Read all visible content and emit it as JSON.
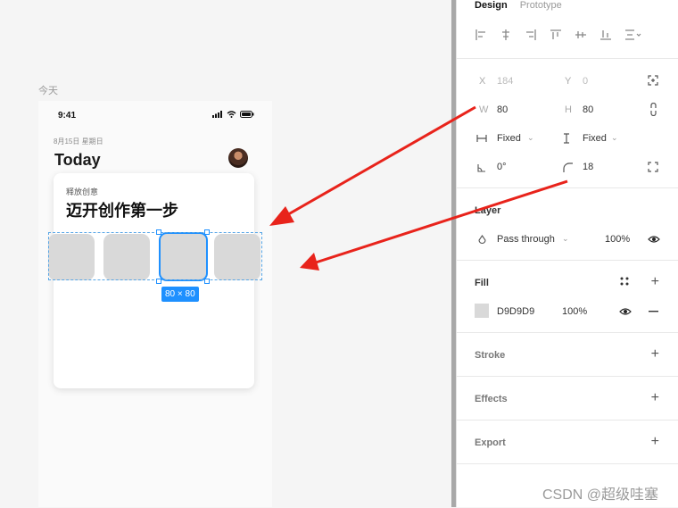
{
  "canvas": {
    "frame_label": "今天",
    "status_time": "9:41",
    "date_line": "8月15日 星期日",
    "heading": "Today",
    "card_subtitle": "释放创意",
    "card_title": "迈开创作第一步",
    "size_badge": "80 × 80"
  },
  "panel": {
    "tabs": [
      "Design",
      "Prototype"
    ],
    "geometry": {
      "x_label": "X",
      "x_value": "184",
      "y_label": "Y",
      "y_value": "0",
      "w_label": "W",
      "w_value": "80",
      "h_label": "H",
      "h_value": "80",
      "h_constraint": "Fixed",
      "v_constraint": "Fixed",
      "rotation": "0°",
      "radius": "18"
    },
    "layer": {
      "title": "Layer",
      "blend": "Pass through",
      "opacity": "100%"
    },
    "fill": {
      "title": "Fill",
      "hex": "D9D9D9",
      "opacity": "100%",
      "color": "#d9d9d9"
    },
    "stroke_title": "Stroke",
    "effects_title": "Effects",
    "export_title": "Export"
  },
  "watermark": "CSDN @超级哇塞",
  "colors": {
    "selection": "#1e90ff",
    "arrow": "#e8231b",
    "tile": "#d9d9d9"
  }
}
